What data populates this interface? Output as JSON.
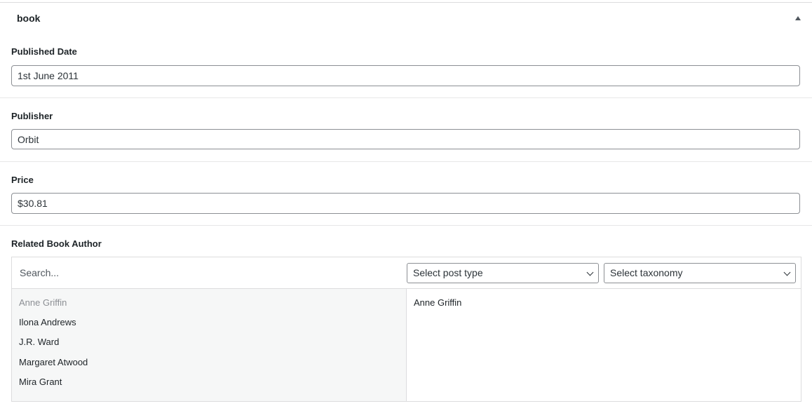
{
  "box": {
    "title": "book"
  },
  "fields": {
    "published_date": {
      "label": "Published Date",
      "value": "1st June 2011"
    },
    "publisher": {
      "label": "Publisher",
      "value": "Orbit"
    },
    "price": {
      "label": "Price",
      "value": "$30.81"
    }
  },
  "relationship": {
    "label": "Related Book Author",
    "search_placeholder": "Search...",
    "post_type_select": "Select post type",
    "taxonomy_select": "Select taxonomy",
    "choices": [
      "Anne Griffin",
      "Ilona Andrews",
      "J.R. Ward",
      "Margaret Atwood",
      "Mira Grant"
    ],
    "selected": [
      "Anne Griffin"
    ]
  }
}
